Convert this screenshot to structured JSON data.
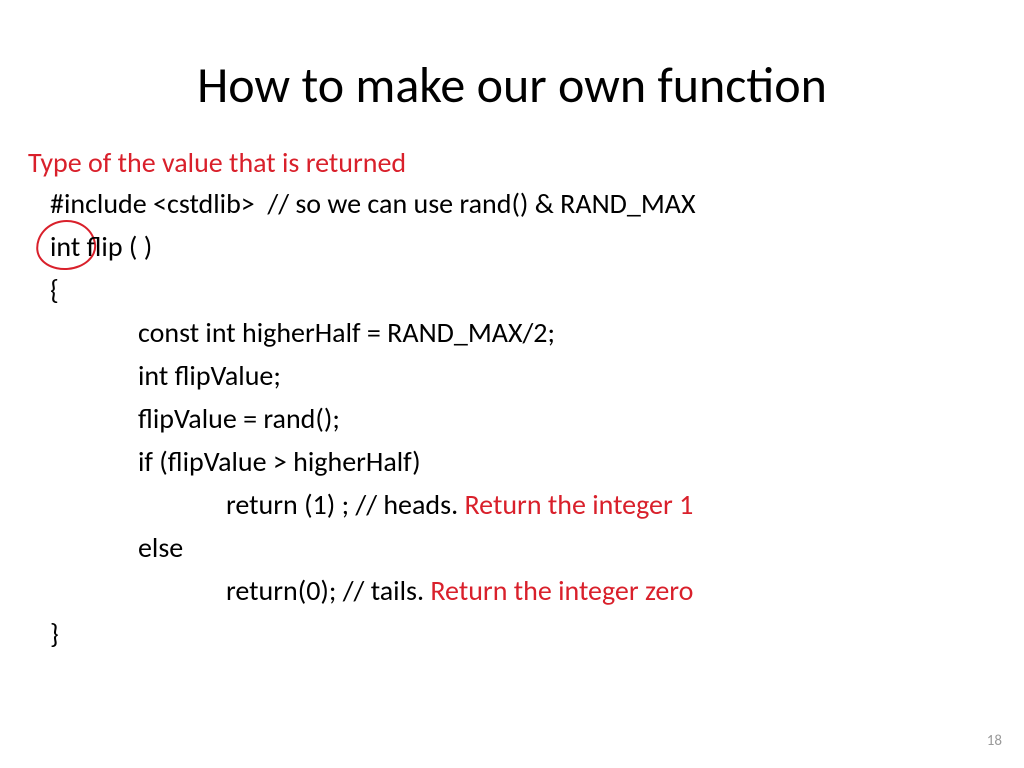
{
  "title": "How to make our own function",
  "annotation": "Type of the value that is returned",
  "code": {
    "l1": "#include <cstdlib>  // so we can use rand() & RAND_MAX",
    "l2": "int flip ( )",
    "l3": "{",
    "l4": "const int higherHalf = RAND_MAX/2;",
    "l5": "int flipValue;",
    "l6": "flipValue = rand();",
    "l7": "if (flipValue > higherHalf)",
    "l8a": "return (1) ; // heads. ",
    "l8b": "Return the integer 1",
    "l9": "else",
    "l10a": "return(0); // tails. ",
    "l10b": "Return the integer zero",
    "l11": "}"
  },
  "page_number": "18"
}
